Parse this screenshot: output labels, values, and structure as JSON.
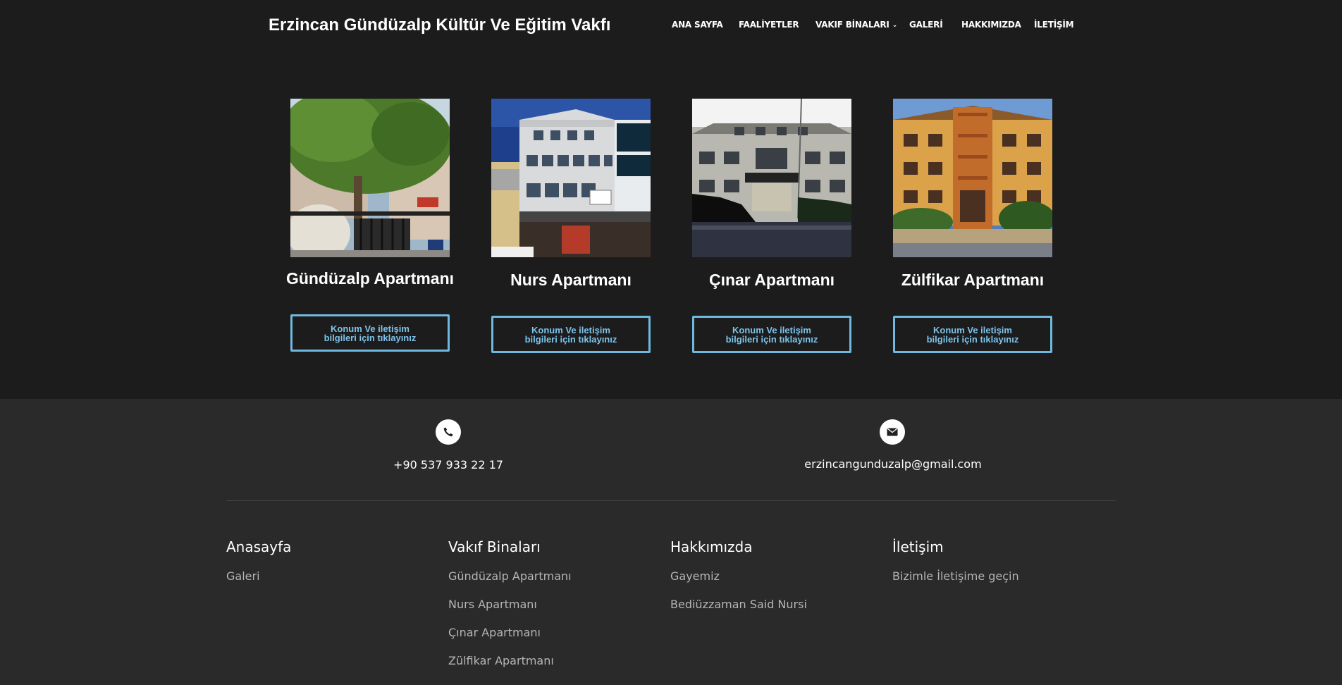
{
  "header": {
    "site_title": "Erzincan Gündüzalp Kültür Ve Eğitim Vakfı",
    "nav": [
      {
        "label": "ANA SAYFA"
      },
      {
        "label": "FAALİYETLER"
      },
      {
        "label": "VAKIF BİNALARI"
      },
      {
        "label": "GALERİ"
      },
      {
        "label": "HAKKIMIZDA"
      },
      {
        "label": "İLETİŞİM"
      }
    ]
  },
  "buildings": [
    {
      "title": "Gündüzalp Apartmanı",
      "button": "Konum Ve iletişim bilgileri için tıklayınız"
    },
    {
      "title": "Nurs Apartmanı",
      "button": "Konum Ve iletişim bilgileri için tıklayınız"
    },
    {
      "title": "Çınar Apartmanı",
      "button": "Konum Ve iletişim bilgileri için tıklayınız"
    },
    {
      "title": "Zülfikar Apartmanı",
      "button": "Konum Ve iletişim bilgileri için tıklayınız"
    }
  ],
  "footer": {
    "phone": "+90 537 933 22 17",
    "email": "erzincangunduzalp@gmail.com",
    "columns": [
      {
        "title": "Anasayfa",
        "links": [
          "Galeri"
        ]
      },
      {
        "title": "Vakıf Binaları",
        "links": [
          "Gündüzalp Apartmanı",
          "Nurs Apartmanı",
          "Çınar Apartmanı",
          "Zülfikar Apartmanı"
        ]
      },
      {
        "title": "Hakkımızda",
        "links": [
          "Gayemiz",
          "Bediüzzaman Said Nursi"
        ]
      },
      {
        "title": "İletişim",
        "links": [
          "Bizimle İletişime geçin"
        ]
      }
    ]
  },
  "colors": {
    "background": "#1c1c1c",
    "footer_background": "#2a2a2a",
    "button_accent": "#6fb8df"
  },
  "icons": {
    "phone": "phone-icon",
    "email": "envelope-icon",
    "nav_dropdown": "chevron-down-icon"
  }
}
